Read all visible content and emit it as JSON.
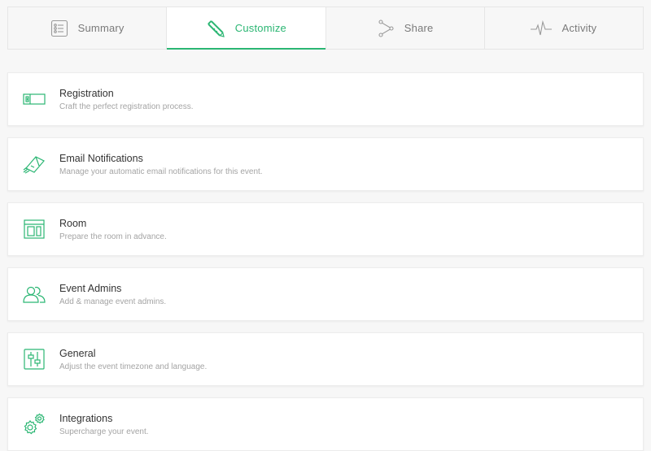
{
  "accent_color": "#2bb673",
  "tabs": [
    {
      "label": "Summary",
      "icon": "list-icon",
      "active": false
    },
    {
      "label": "Customize",
      "icon": "pencil-ruler-icon",
      "active": true
    },
    {
      "label": "Share",
      "icon": "share-icon",
      "active": false
    },
    {
      "label": "Activity",
      "icon": "pulse-icon",
      "active": false
    }
  ],
  "cards": [
    {
      "title": "Registration",
      "description": "Craft the perfect registration process.",
      "icon": "ticket-icon"
    },
    {
      "title": "Email Notifications",
      "description": "Manage your automatic email notifications for this event.",
      "icon": "paper-plane-icon"
    },
    {
      "title": "Room",
      "description": "Prepare the room in advance.",
      "icon": "room-layout-icon"
    },
    {
      "title": "Event Admins",
      "description": "Add & manage event admins.",
      "icon": "users-icon"
    },
    {
      "title": "General",
      "description": "Adjust the event timezone and language.",
      "icon": "sliders-icon"
    },
    {
      "title": "Integrations",
      "description": "Supercharge your event.",
      "icon": "gears-icon"
    }
  ]
}
